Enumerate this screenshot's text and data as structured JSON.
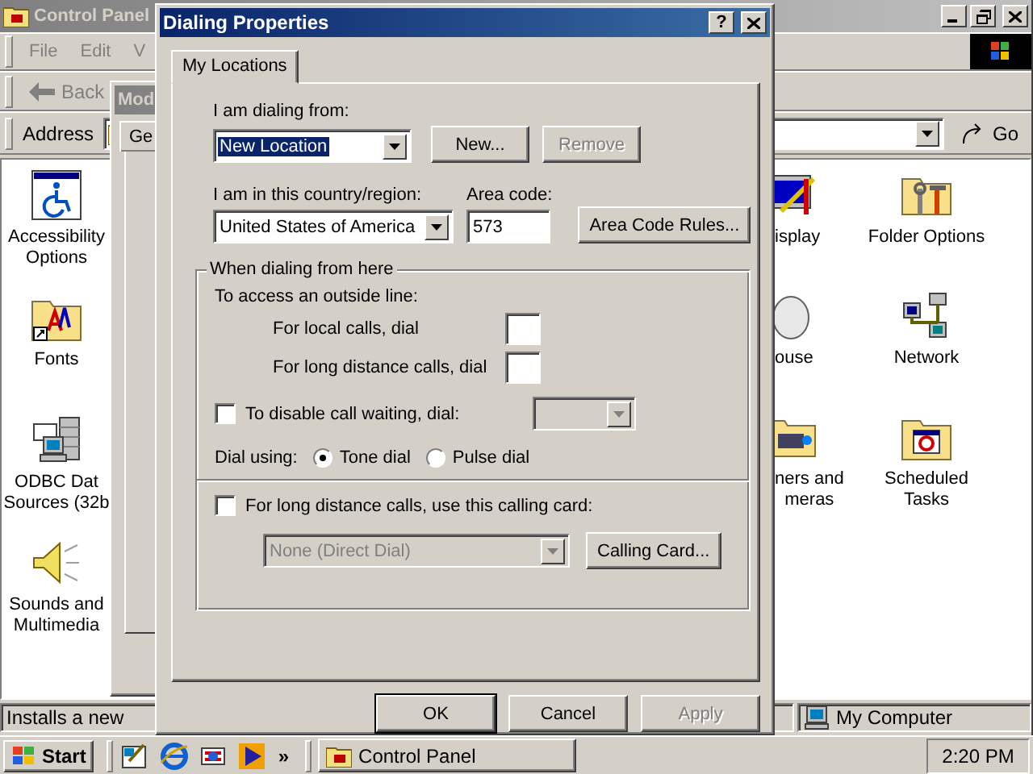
{
  "control_panel": {
    "title": "Control Panel",
    "menu": [
      "File",
      "Edit",
      "V"
    ],
    "back_button": "Back",
    "address_label": "Address",
    "go_button": "Go",
    "icons_left": [
      {
        "kind": "accessibility",
        "label": [
          "Accessibility",
          "Options"
        ]
      },
      {
        "kind": "fonts",
        "label": [
          "Fonts"
        ]
      },
      {
        "kind": "odbc",
        "label": [
          "ODBC Dat",
          "Sources (32b"
        ]
      },
      {
        "kind": "sounds",
        "label": [
          "Sounds and",
          "Multimedia"
        ]
      }
    ],
    "icons_right": [
      {
        "kind": "display",
        "label": [
          "isplay"
        ]
      },
      {
        "kind": "folder-options",
        "label": [
          "Folder Options"
        ]
      },
      {
        "kind": "mouse",
        "label": [
          "ouse"
        ]
      },
      {
        "kind": "network",
        "label": [
          "Network"
        ]
      },
      {
        "kind": "scanners",
        "label": [
          "ners and",
          "meras"
        ]
      },
      {
        "kind": "scheduled",
        "label": [
          "Scheduled",
          "Tasks"
        ]
      }
    ],
    "status_text": "Installs a new",
    "status_zone": "My Computer"
  },
  "modems_window": {
    "title": "Mod",
    "tab": "Ge"
  },
  "dialog": {
    "title": "Dialing Properties",
    "help_button": "?",
    "tabs": [
      {
        "label": "My Locations",
        "selected": true
      }
    ],
    "dialing_from": {
      "label": "I am dialing from:",
      "value": "New Location"
    },
    "location_buttons": [
      {
        "label": "New...",
        "disabled": false
      },
      {
        "label": "Remove",
        "disabled": true
      }
    ],
    "country": {
      "label": "I am in this country/region:",
      "value": "United States of America"
    },
    "area_code": {
      "label": "Area code:",
      "value": "573"
    },
    "area_code_rules_button": "Area Code Rules...",
    "group_title": "When dialing from here",
    "outside_line_label": "To access an outside line:",
    "local_label": "For local calls, dial",
    "long_distance_label": "For long distance calls, dial",
    "call_waiting": {
      "label": "To disable call waiting, dial:",
      "checked": false
    },
    "dial_using": {
      "label": "Dial using:",
      "options": [
        {
          "label": "Tone dial",
          "selected": true
        },
        {
          "label": "Pulse dial",
          "selected": false
        }
      ]
    },
    "calling_card": {
      "label": "For long distance calls, use this calling card:",
      "checked": false,
      "value": "None (Direct Dial)",
      "button": "Calling Card..."
    },
    "footer_buttons": [
      {
        "label": "OK",
        "disabled": false
      },
      {
        "label": "Cancel",
        "disabled": false
      },
      {
        "label": "Apply",
        "disabled": true
      }
    ]
  },
  "taskbar": {
    "start": "Start",
    "chevron": "»",
    "tasks": [
      {
        "label": "Control Panel",
        "selected": false
      }
    ],
    "clock": "2:20 PM"
  }
}
